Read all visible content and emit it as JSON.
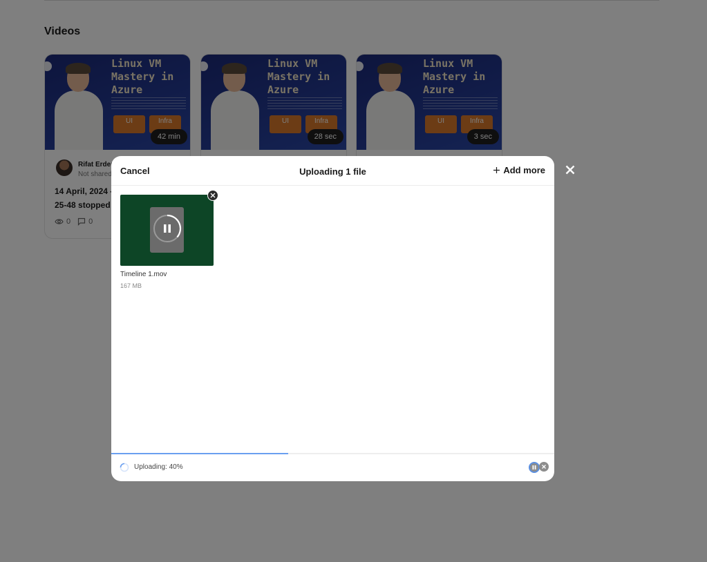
{
  "page": {
    "section_title": "Videos",
    "videos": [
      {
        "thumbnail_title": "Linux VM Mastery in Azure",
        "tags": [
          "UI",
          "Infra"
        ],
        "duration": "42 min",
        "author": "Rifat Erden",
        "share_status": "Not shared",
        "title_line1": "14 April, 2024 -",
        "title_line2": "25-48 stopped",
        "views": "0",
        "comments": "0"
      },
      {
        "thumbnail_title": "Linux VM Mastery in Azure",
        "tags": [
          "UI",
          "Infra"
        ],
        "duration": "28 sec"
      },
      {
        "thumbnail_title": "Linux VM Mastery in Azure",
        "tags": [
          "UI",
          "Infra"
        ],
        "duration": "3 sec"
      }
    ]
  },
  "modal": {
    "cancel_label": "Cancel",
    "title": "Uploading 1 file",
    "add_more_label": "Add more",
    "file": {
      "name": "Timeline 1.mov",
      "size": "167 MB"
    },
    "progress_fraction": 0.4,
    "status_text": "Uploading: 40%"
  },
  "icons": {
    "close": "close-icon",
    "plus": "plus-icon",
    "pause": "pause-icon",
    "eye": "eye-icon",
    "comment": "comment-icon"
  },
  "colors": {
    "overlay": "#000000",
    "file_tile": "#0d4526",
    "progress_fill": "#6a9ff0",
    "thumb_tag": "#d9792b"
  }
}
